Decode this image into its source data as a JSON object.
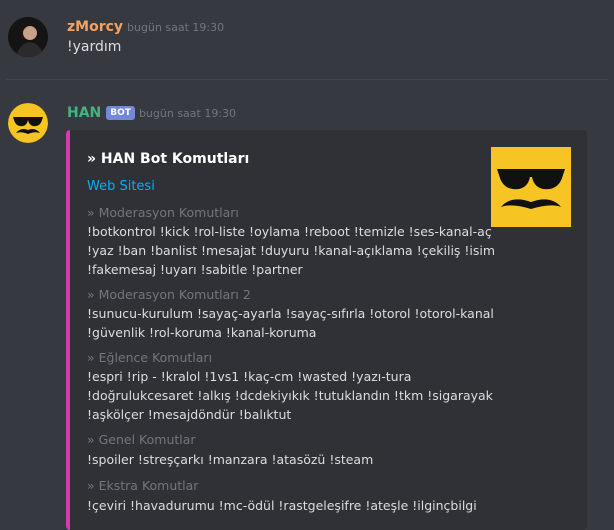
{
  "messages": [
    {
      "author": "zMorcy",
      "author_color": "#f4a261",
      "timestamp": "bugün saat 19:30",
      "text": "!yardım"
    },
    {
      "author": "HAN",
      "author_color": "#43b581",
      "bot_badge": "BOT",
      "timestamp": "bugün saat 19:30"
    }
  ],
  "embed": {
    "title": "» HAN Bot Komutları",
    "link": "Web Sitesi",
    "accent_color": "#d63aaf",
    "thumbnail_icon": "sunglasses-mustache-icon",
    "fields": [
      {
        "name": "» Moderasyon Komutları",
        "value": "!botkontrol !kick !rol-liste !oylama !reboot !temizle !ses-kanal-aç\n!yaz !ban !banlist !mesajat !duyuru !kanal-açıklama !çekiliş !isim\n!fakemesaj !uyarı !sabitle !partner"
      },
      {
        "name": "» Moderasyon Komutları 2",
        "value": "!sunucu-kurulum !sayaç-ayarla !sayaç-sıfırla !otorol !otorol-kanal\n!güvenlik !rol-koruma !kanal-koruma"
      },
      {
        "name": "» Eğlence Komutları",
        "value": "!espri !rip - !kralol !1vs1 !kaç-cm !wasted !yazı-tura\n!doğrulukcesaret !alkış !dcdekiyıkık !tutuklandın !tkm !sigarayak\n!aşkölçer !mesajdöndür !balıktut"
      },
      {
        "name": "» Genel Komutlar",
        "value": "!spoiler !streşçarkı !manzara !atasözü !steam"
      },
      {
        "name": "» Ekstra Komutlar",
        "value": "!çeviri !havadurumu !mc-ödül !rastgeleşifre !ateşle !ilginçbilgi"
      }
    ]
  }
}
